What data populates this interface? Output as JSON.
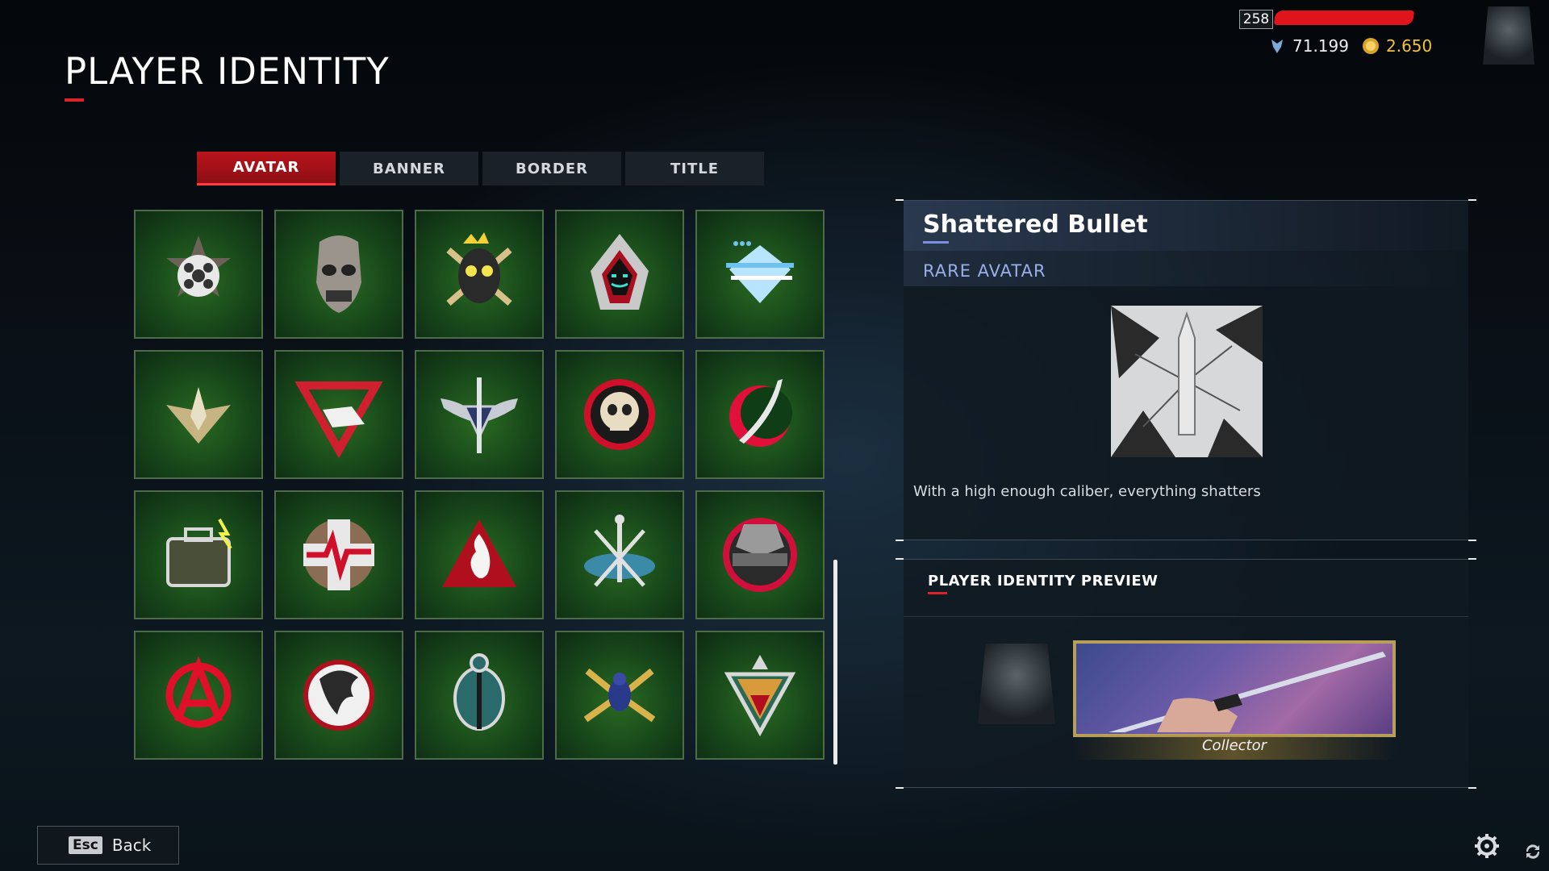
{
  "page": {
    "title": "PLAYER IDENTITY"
  },
  "profile": {
    "level": "258",
    "xp": "71.199",
    "credits": "2.650"
  },
  "tabs": [
    {
      "label": "AVATAR",
      "active": true
    },
    {
      "label": "BANNER",
      "active": false
    },
    {
      "label": "BORDER",
      "active": false
    },
    {
      "label": "TITLE",
      "active": false
    }
  ],
  "avatars": [
    "revolver-emblem",
    "skull-mask",
    "bearded-goggles-man",
    "hooded-hacker",
    "glitch-diamond",
    "golden-jet",
    "sneaker-triangle",
    "winged-sword",
    "crosshair-skull",
    "crimson-sword",
    "electric-briefcase",
    "heartbeat-cross",
    "flame-triangle",
    "crossed-tools",
    "ammo-belt-emblem",
    "anarchy-symbol",
    "dragon-circle",
    "turtle-shell",
    "golden-spider",
    "viper-emblem"
  ],
  "detail": {
    "title": "Shattered Bullet",
    "rarity": "RARE AVATAR",
    "description": "With a high enough caliber, everything shatters"
  },
  "preview": {
    "title": "PLAYER IDENTITY PREVIEW",
    "banner_title": "Collector"
  },
  "footer": {
    "back_key": "Esc",
    "back_label": "Back"
  },
  "colors": {
    "accent_red": "#d8232a",
    "rarity_blue": "#9aaee8",
    "gold": "#f2c23c",
    "tile_green": "#17461a"
  }
}
